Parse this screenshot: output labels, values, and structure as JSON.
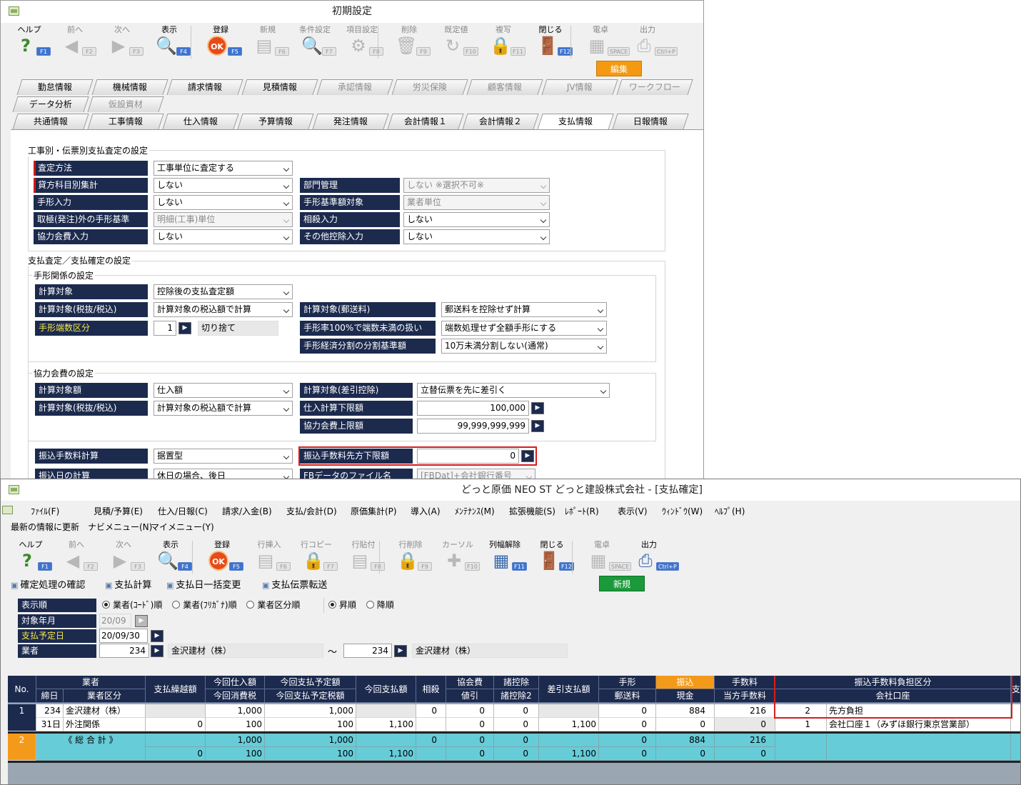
{
  "w1": {
    "title": "初期設定",
    "toolbar": [
      {
        "label": "ヘルプ",
        "key": "F1",
        "icon": "?",
        "enabled": true
      },
      {
        "label": "前へ",
        "key": "F2",
        "icon": "◀",
        "enabled": false
      },
      {
        "label": "次へ",
        "key": "F3",
        "icon": "▶",
        "enabled": false
      },
      {
        "label": "表示",
        "key": "F4",
        "icon": "🔍",
        "enabled": true
      },
      {
        "label": "登録",
        "key": "F5",
        "icon": "OK",
        "enabled": true
      },
      {
        "label": "新規",
        "key": "F6",
        "icon": "▤",
        "enabled": false
      },
      {
        "label": "条件設定",
        "key": "F7",
        "icon": "🔍",
        "enabled": false
      },
      {
        "label": "項目設定",
        "key": "F8",
        "icon": "⚙",
        "enabled": false
      },
      {
        "label": "削除",
        "key": "F9",
        "icon": "🗑",
        "enabled": false
      },
      {
        "label": "既定値",
        "key": "F10",
        "icon": "↻",
        "enabled": false
      },
      {
        "label": "複写",
        "key": "F11",
        "icon": "🔒",
        "enabled": false
      },
      {
        "label": "閉じる",
        "key": "F12",
        "icon": "🚪",
        "enabled": true
      },
      {
        "label": "電卓",
        "key": "SPACE",
        "icon": "▦",
        "enabled": false
      },
      {
        "label": "出力",
        "key": "Ctrl+P",
        "icon": "⎙",
        "enabled": false
      }
    ],
    "edit_badge": "編集",
    "tabs_row1": [
      {
        "label": "勤怠情報",
        "enabled": true
      },
      {
        "label": "機械情報",
        "enabled": true
      },
      {
        "label": "請求情報",
        "enabled": true
      },
      {
        "label": "見積情報",
        "enabled": true
      },
      {
        "label": "承認情報",
        "enabled": false
      },
      {
        "label": "労災保険",
        "enabled": false
      },
      {
        "label": "顧客情報",
        "enabled": false
      },
      {
        "label": "JV情報",
        "enabled": false
      },
      {
        "label": "ワークフロー",
        "enabled": false
      }
    ],
    "tabs_row2": [
      {
        "label": "データ分析",
        "enabled": true
      },
      {
        "label": "仮設資材",
        "enabled": false
      }
    ],
    "tabs_row3": [
      {
        "label": "共通情報",
        "enabled": true
      },
      {
        "label": "工事情報",
        "enabled": true
      },
      {
        "label": "仕入情報",
        "enabled": true
      },
      {
        "label": "予算情報",
        "enabled": true
      },
      {
        "label": "発注情報",
        "enabled": true
      },
      {
        "label": "会計情報１",
        "enabled": true
      },
      {
        "label": "会計情報２",
        "enabled": true
      },
      {
        "label": "支払情報",
        "enabled": true,
        "active": true
      },
      {
        "label": "日報情報",
        "enabled": true
      }
    ],
    "s1": {
      "title": "工事別・伝票別支払査定の設定",
      "f1": {
        "label": "査定方法",
        "value": "工事単位に査定する"
      },
      "f2": {
        "label": "貸方科目別集計",
        "value": "しない"
      },
      "f3": {
        "label": "部門管理",
        "value": "しない ※選択不可※"
      },
      "f4": {
        "label": "手形入力",
        "value": "しない"
      },
      "f5": {
        "label": "手形基準額対象",
        "value": "業者単位"
      },
      "f6": {
        "label": "取極(発注)外の手形基準",
        "value": "明細(工事)単位"
      },
      "f7": {
        "label": "相殺入力",
        "value": "しない"
      },
      "f8": {
        "label": "協力会費入力",
        "value": "しない"
      },
      "f9": {
        "label": "その他控除入力",
        "value": "しない"
      }
    },
    "s2": {
      "title": "支払査定／支払確定の設定",
      "sub1": "手形関係の設定",
      "f1": {
        "label": "計算対象",
        "value": "控除後の支払査定額"
      },
      "f2": {
        "label": "計算対象(税抜/税込)",
        "value": "計算対象の税込額で計算"
      },
      "f3": {
        "label": "計算対象(郵送料)",
        "value": "郵送料を控除せず計算"
      },
      "f4": {
        "label": "手形端数区分",
        "num": "1",
        "value": "切り捨て"
      },
      "f5": {
        "label": "手形率100%で端数未満の扱い",
        "value": "端数処理せず全額手形にする"
      },
      "f6": {
        "label": "手形経済分割の分割基準額",
        "value": "10万未満分割しない(通常)"
      },
      "sub2": "協力会費の設定",
      "f7": {
        "label": "計算対象額",
        "value": "仕入額"
      },
      "f8": {
        "label": "計算対象(差引控除)",
        "value": "立替伝票を先に差引く"
      },
      "f9": {
        "label": "計算対象(税抜/税込)",
        "value": "計算対象の税込額で計算"
      },
      "f10": {
        "label": "仕入計算下限額",
        "value": "100,000"
      },
      "f11": {
        "label": "協力会費上限額",
        "value": "99,999,999,999"
      },
      "f12": {
        "label": "振込手数料計算",
        "value": "据置型"
      },
      "f13": {
        "label": "振込手数料先方下限額",
        "value": "0"
      },
      "f14": {
        "label": "振込日の計算",
        "value": "休日の場合、後日"
      },
      "f15": {
        "label": "FBデータのファイル名",
        "value": "[FBDat]+会社銀行番号"
      }
    }
  },
  "w2": {
    "title": "どっと原価 NEO ST どっと建設株式会社 - [支払確定]",
    "menu": [
      "ﾌｧｲﾙ(F)",
      "見積/予算(E)",
      "仕入/日報(C)",
      "請求/入金(B)",
      "支払/会計(D)",
      "原価集計(P)",
      "導入(A)",
      "ﾒﾝﾃﾅﾝｽ(M)",
      "拡張機能(S)",
      "ﾚﾎﾟｰﾄ(R)",
      "表示(V)",
      "ｳｨﾝﾄﾞｳ(W)",
      "ﾍﾙﾌﾟ(H)"
    ],
    "quick": [
      "最新の情報に更新",
      "ナビメニュー(N)",
      "マイメニュー(Y)"
    ],
    "toolbar": [
      {
        "label": "ヘルプ",
        "key": "F1",
        "icon": "?",
        "enabled": true
      },
      {
        "label": "前へ",
        "key": "F2",
        "icon": "◀",
        "enabled": false
      },
      {
        "label": "次へ",
        "key": "F3",
        "icon": "▶",
        "enabled": false
      },
      {
        "label": "表示",
        "key": "F4",
        "icon": "🔍",
        "enabled": true
      },
      {
        "label": "登録",
        "key": "F5",
        "icon": "OK",
        "enabled": true
      },
      {
        "label": "行挿入",
        "key": "F6",
        "icon": "▤",
        "enabled": false
      },
      {
        "label": "行コピー",
        "key": "F7",
        "icon": "🔒",
        "enabled": false
      },
      {
        "label": "行貼付",
        "key": "F8",
        "icon": "▤",
        "enabled": false
      },
      {
        "label": "行削除",
        "key": "F9",
        "icon": "🔒",
        "enabled": false
      },
      {
        "label": "カーソル",
        "key": "F10",
        "icon": "✚",
        "enabled": false
      },
      {
        "label": "列幅解除",
        "key": "F11",
        "icon": "▦",
        "enabled": true
      },
      {
        "label": "閉じる",
        "key": "F12",
        "icon": "🚪",
        "enabled": true
      },
      {
        "label": "電卓",
        "key": "SPACE",
        "icon": "▦",
        "enabled": false
      },
      {
        "label": "出力",
        "key": "Ctrl+P",
        "icon": "⎙",
        "enabled": true
      }
    ],
    "commands": [
      "確定処理の確認",
      "支払計算",
      "支払日一括変更",
      "支払伝票転送"
    ],
    "new_badge": "新規",
    "filter": {
      "order_label": "表示順",
      "order_opts": [
        "業者(ｺｰﾄﾞ)順",
        "業者(ﾌﾘｶﾞﾅ)順",
        "業者区分順"
      ],
      "sort_opts": [
        "昇順",
        "降順"
      ],
      "month_label": "対象年月",
      "month_value": "20/09",
      "pay_label": "支払予定日",
      "pay_value": "20/09/30",
      "vendor_label": "業者",
      "vendor_from": "234",
      "vendor_from_name": "金沢建材（株）",
      "tilde": "～",
      "vendor_to": "234",
      "vendor_to_name": "金沢建材（株）"
    },
    "grid": {
      "h_no": "No.",
      "h_vendor": "業者",
      "h_close": "締日",
      "h_vendor_cat": "業者区分",
      "h_carry": "支払繰越額",
      "h_purchase": "今回仕入額",
      "h_tax": "今回消費税",
      "h_plan": "今回支払予定額",
      "h_plan_tax": "今回支払予定税額",
      "h_pay": "今回支払額",
      "h_offset": "相殺",
      "h_coop": "協会費",
      "h_disc": "値引",
      "h_ded": "諸控除",
      "h_ded2": "諸控除2",
      "h_net": "差引支払額",
      "h_bill": "手形",
      "h_post": "郵送料",
      "h_transfer": "振込",
      "h_cash": "現金",
      "h_fee": "手数料",
      "h_our_fee": "当方手数料",
      "h_fee_div": "振込手数料負担区分",
      "h_account": "会社口座",
      "h_more": "支",
      "row1": {
        "no": "1",
        "code": "234",
        "name": "金沢建材（株）",
        "close": "31日",
        "cat": "外注関係",
        "carry": "0",
        "purchase": "1,000",
        "tax": "100",
        "plan": "1,000",
        "plan_tax": "100",
        "pay": "1,100",
        "offset": "0",
        "coop": "0",
        "disc": "0",
        "ded": "0",
        "ded2": "0",
        "net": "1,100",
        "bill": "0",
        "post": "0",
        "transfer": "884",
        "cash": "0",
        "fee": "216",
        "our_fee": "0",
        "fee_code": "2",
        "fee_name": "先方負担",
        "acct_code": "1",
        "acct_name": "会社口座１（みずほ銀行東京営業部）"
      },
      "total": {
        "no": "2",
        "label": "《 総 合 計 》",
        "carry": "0",
        "purchase": "1,000",
        "tax": "100",
        "plan": "1,000",
        "plan_tax": "100",
        "pay": "1,100",
        "offset": "0",
        "coop": "0",
        "disc": "0",
        "ded": "0",
        "ded2": "0",
        "net": "1,100",
        "bill": "0",
        "post": "0",
        "transfer": "884",
        "cash": "0",
        "fee": "216",
        "our_fee": "0"
      }
    }
  }
}
